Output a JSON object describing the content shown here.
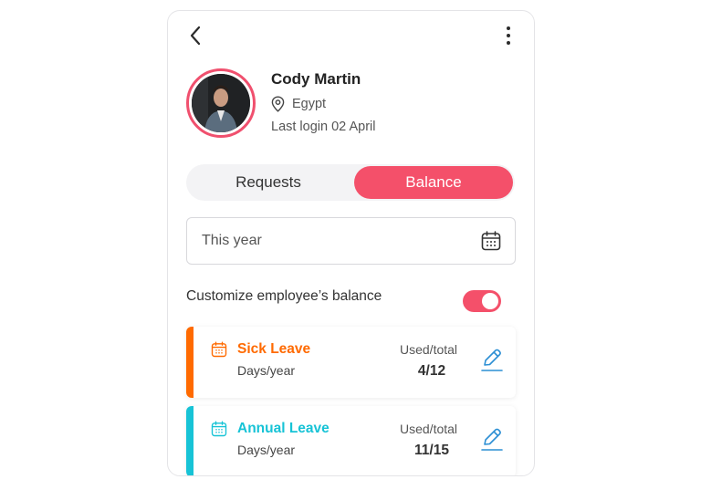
{
  "profile": {
    "name": "Cody Martin",
    "location": "Egypt",
    "last_login": "Last login 02 April"
  },
  "tabs": {
    "requests": "Requests",
    "balance": "Balance",
    "active": "balance"
  },
  "date_filter": {
    "value": "This year"
  },
  "customize": {
    "label": "Customize employee’s balance",
    "enabled": true
  },
  "leaves": [
    {
      "title": "Sick Leave",
      "unit": "Days/year",
      "used_total_label": "Used/total",
      "value": "4/12",
      "color": "#ff6a00"
    },
    {
      "title": "Annual Leave",
      "unit": "Days/year",
      "used_total_label": "Used/total",
      "value": "11/15",
      "color": "#17c3d6"
    }
  ],
  "colors": {
    "accent": "#f4506a",
    "edit_icon": "#2c8fd4"
  },
  "icons": [
    "back-chevron-icon",
    "more-vertical-icon",
    "location-pin-icon",
    "calendar-icon",
    "pencil-edit-icon"
  ]
}
